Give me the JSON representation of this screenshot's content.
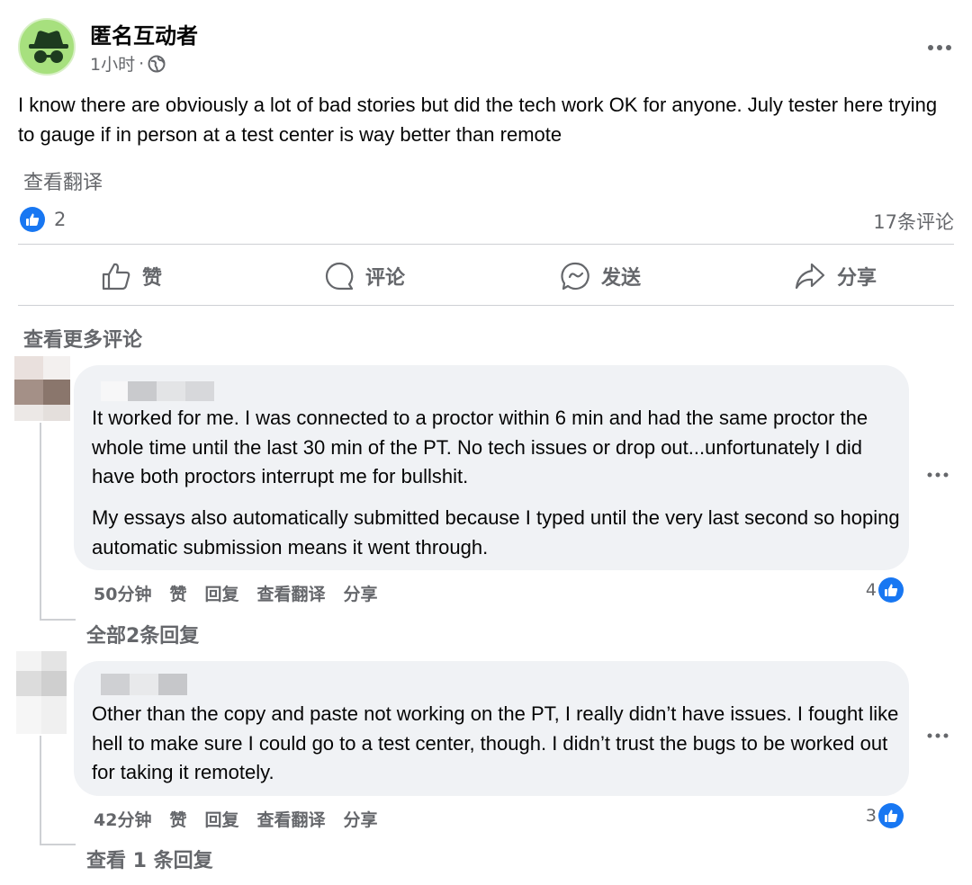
{
  "post": {
    "author": "匿名互动者",
    "time": "1小时",
    "separator": "·",
    "text": "I know there are obviously a lot of bad stories but did the tech work OK for anyone. July tester here trying to gauge if in person at a test center is way better than remote",
    "see_translation": "查看翻译",
    "reaction_count": "2",
    "comment_count": "17条评论",
    "icons": {
      "avatar": "incognito-icon",
      "audience": "globe-icon",
      "reaction": "like-icon",
      "more": "more-icon"
    }
  },
  "actions": {
    "like": "赞",
    "comment": "评论",
    "send": "发送",
    "share": "分享"
  },
  "view_more_comments": "查看更多评论",
  "comments": [
    {
      "paragraphs": [
        "It worked for me. I was connected to a proctor within 6 min and had the same proctor the whole time until the last 30 min of the PT. No tech issues or drop out...unfortunately I did have both proctors interrupt me for bullshit.",
        "My essays also automatically submitted because I typed until the very last second so hoping automatic submission means it went through."
      ],
      "time": "50分钟",
      "like": "赞",
      "reply": "回复",
      "translate": "查看翻译",
      "share": "分享",
      "likes": "4",
      "replies": "全部2条回复"
    },
    {
      "paragraphs": [
        "Other than the copy and paste not working on the PT, I really didn’t have issues. I fought like hell to make sure I could go to a test center, though. I didn’t trust the bugs to be worked out for taking it remotely."
      ],
      "time": "42分钟",
      "like": "赞",
      "reply": "回复",
      "translate": "查看翻译",
      "share": "分享",
      "likes": "3",
      "replies": "查看 1 条回复"
    }
  ],
  "colors": {
    "brand_blue": "#1877f2",
    "secondary_text": "#65676b",
    "bubble_bg": "#f0f2f5",
    "divider": "#ced0d4",
    "avatar_green": "#a7e07e"
  }
}
